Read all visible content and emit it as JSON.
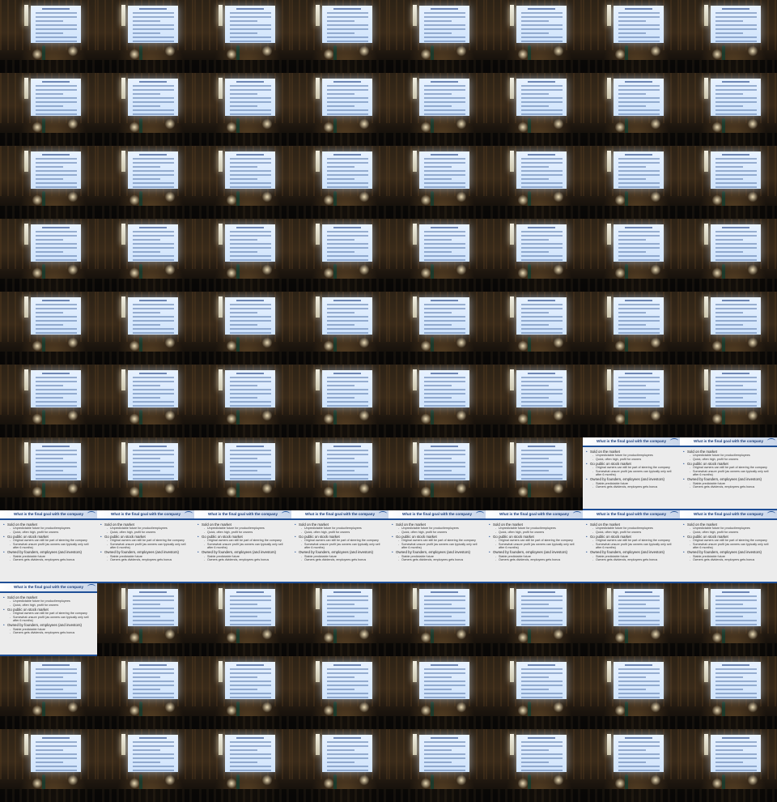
{
  "layout": {
    "columns": 8,
    "rows": 11,
    "slide_cells": [
      54,
      55,
      56,
      57,
      58,
      59,
      60,
      61,
      62,
      63,
      64
    ]
  },
  "cells": {
    "video_frame": "lecture-hall-frame",
    "slide_capture": "lecture-slide"
  },
  "slide": {
    "title": "What is the final goal with the company",
    "points": [
      {
        "level": 1,
        "text": "Sold on the market"
      },
      {
        "level": 2,
        "text": "Unpredictable future for product/employees"
      },
      {
        "level": 2,
        "text": "Quick, often high, profit for owners"
      },
      {
        "level": 1,
        "text": "Go public on stock market"
      },
      {
        "level": 2,
        "text": "Original owners can still be part of  steering the company"
      },
      {
        "level": 2,
        "text": "Somewhat unsure profit (as owners can typically only sell after 6 months)"
      },
      {
        "level": 1,
        "text": "Owned by founders, employees (and investors)"
      },
      {
        "level": 2,
        "text": "Stable predictable future"
      },
      {
        "level": 2,
        "text": "Owners gets dividends, employees gets bonus"
      }
    ]
  }
}
